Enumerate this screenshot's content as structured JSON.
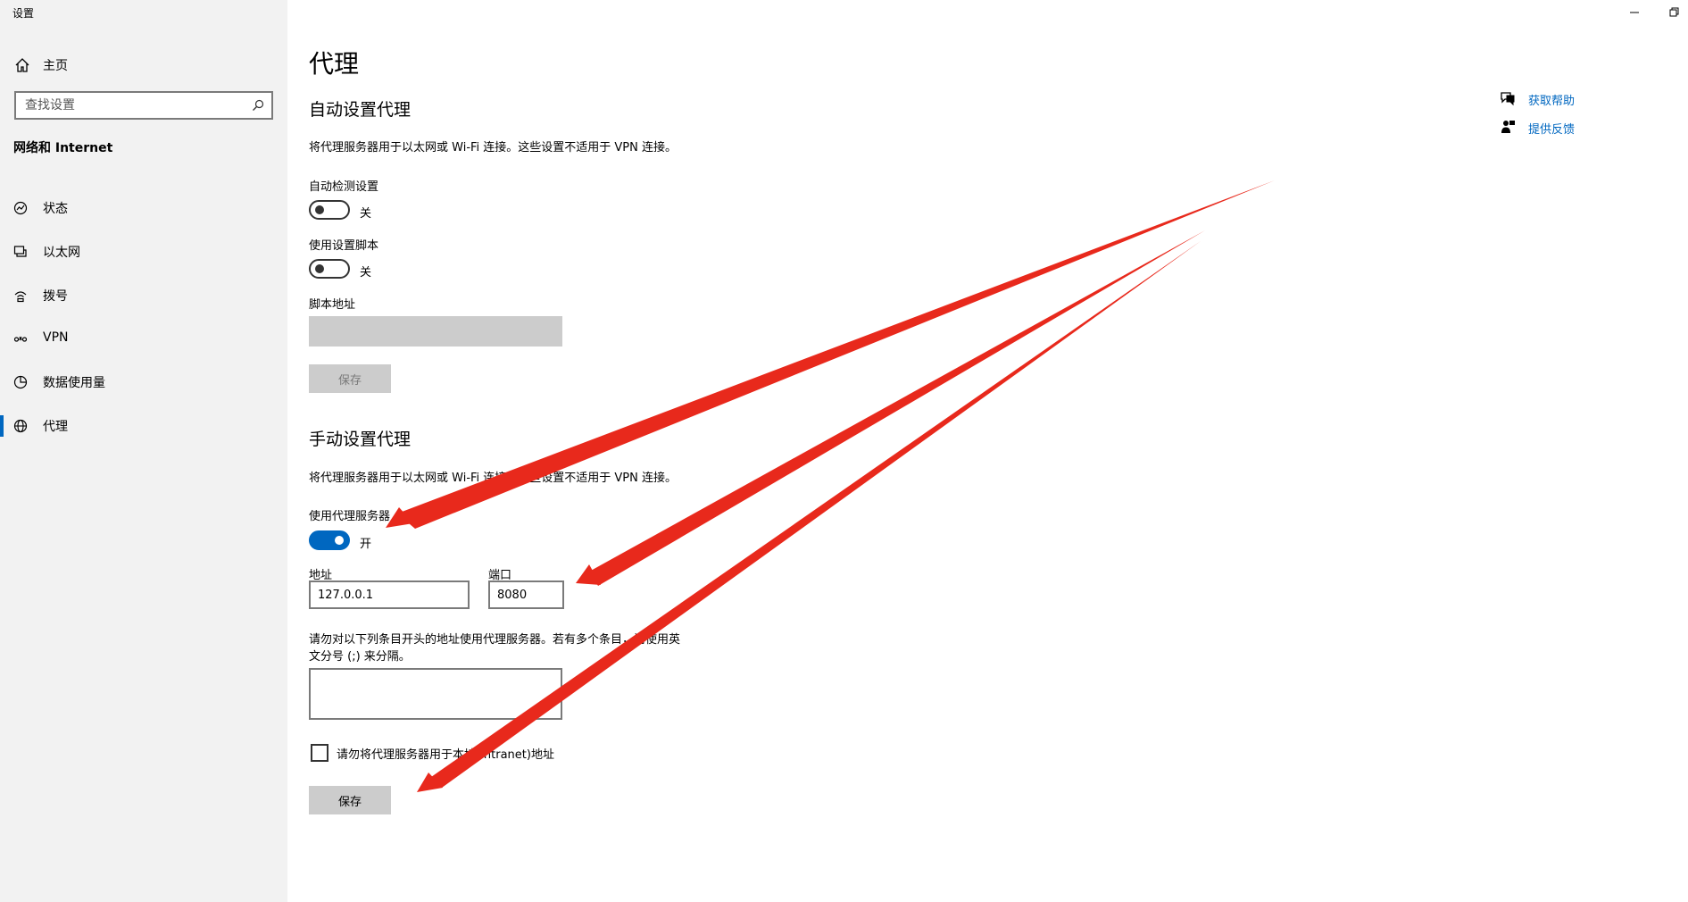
{
  "window": {
    "title": "设置"
  },
  "sidebar": {
    "home_label": "主页",
    "search_placeholder": "查找设置",
    "section_label": "网络和 Internet",
    "items": [
      {
        "label": "状态",
        "icon": "status-icon"
      },
      {
        "label": "以太网",
        "icon": "ethernet-icon"
      },
      {
        "label": "拨号",
        "icon": "dialup-icon"
      },
      {
        "label": "VPN",
        "icon": "vpn-icon"
      },
      {
        "label": "数据使用量",
        "icon": "data-usage-icon"
      },
      {
        "label": "代理",
        "icon": "globe-icon",
        "active": true
      }
    ]
  },
  "main": {
    "title": "代理",
    "auto": {
      "heading": "自动设置代理",
      "description": "将代理服务器用于以太网或 Wi-Fi 连接。这些设置不适用于 VPN 连接。",
      "detect_label": "自动检测设置",
      "detect_state": "关",
      "script_label": "使用设置脚本",
      "script_state": "关",
      "script_address_label": "脚本地址",
      "script_address_value": "",
      "save_label": "保存"
    },
    "manual": {
      "heading": "手动设置代理",
      "description": "将代理服务器用于以太网或 Wi-Fi 连接。这些设置不适用于 VPN 连接。",
      "use_proxy_label": "使用代理服务器",
      "use_proxy_state": "开",
      "address_label": "地址",
      "address_value": "127.0.0.1",
      "port_label": "端口",
      "port_value": "8080",
      "exceptions_line1": "请勿对以下列条目开头的地址使用代理服务器。若有多个条目，请使用英",
      "exceptions_line2": "文分号 (;) 来分隔。",
      "exceptions_value": "",
      "local_checkbox_label": "请勿将代理服务器用于本地(Intranet)地址",
      "save_label": "保存"
    }
  },
  "help": {
    "get_help": "获取帮助",
    "feedback": "提供反馈"
  },
  "colors": {
    "accent": "#0067c0",
    "sidebar_bg": "#f2f2f2",
    "annotation_arrow": "#e8291c"
  }
}
